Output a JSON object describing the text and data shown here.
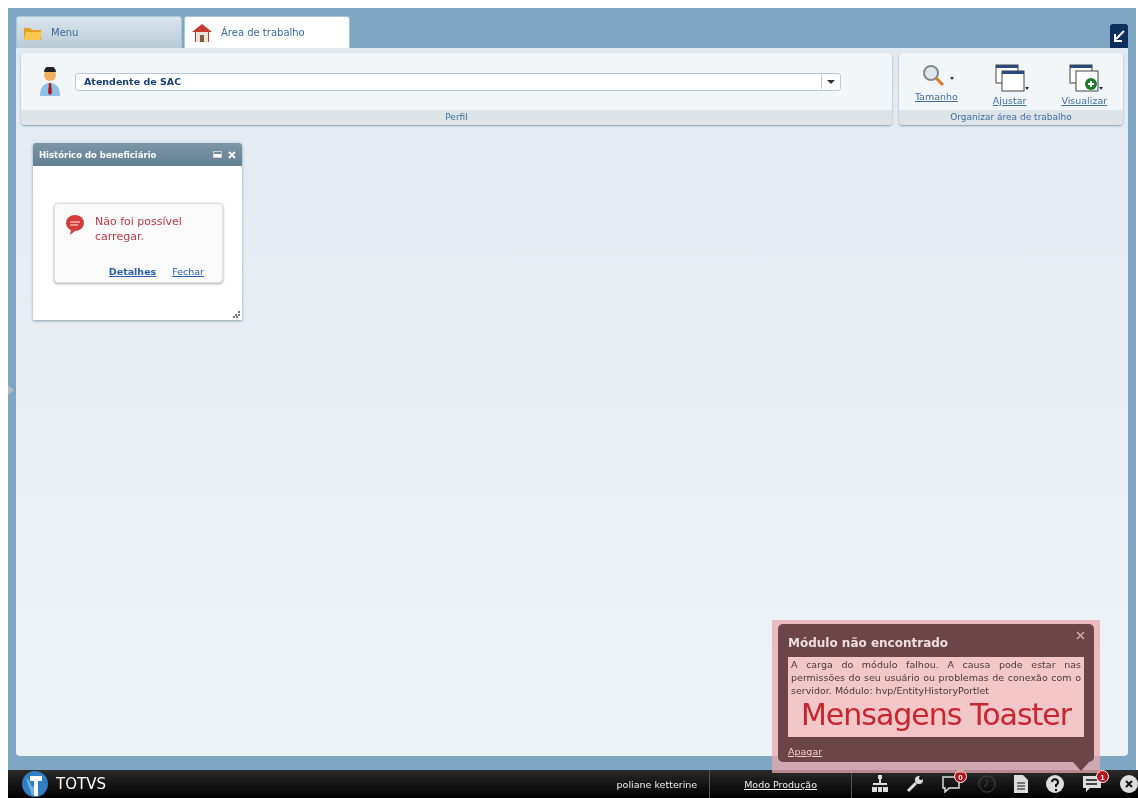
{
  "tabs": [
    {
      "label": "Menu",
      "kind": "folder",
      "selected": false
    },
    {
      "label": "Área de trabalho",
      "kind": "house",
      "selected": true
    }
  ],
  "profile": {
    "value": "Atendente de SAC",
    "section_label": "Perfil"
  },
  "organize": {
    "buttons": [
      {
        "label": "Tamanho",
        "kind": "zoom"
      },
      {
        "label": "Ajustar",
        "kind": "fit"
      },
      {
        "label": "Visualizar",
        "kind": "add"
      }
    ],
    "section_label": "Organizar área de trabalho"
  },
  "portlet": {
    "title": "Histórico do beneficiário",
    "error": {
      "message": "Não foi possível carregar.",
      "links": [
        {
          "label": "Detalhes",
          "primary": true
        },
        {
          "label": "Fechar",
          "primary": false
        }
      ]
    }
  },
  "toaster": {
    "title": "Módulo não encontrado",
    "message": "A carga do módulo falhou. A causa pode estar nas permissões do seu usuário ou problemas de conexão com o servidor. Módulo: hvp/EntityHistoryPortlet",
    "annotation": "Mensagens Toaster",
    "action": "Apagar"
  },
  "status_bar": {
    "brand": "TOTVS",
    "user": "poliane ketterine",
    "mode": "Modo Produção",
    "tools": [
      {
        "kind": "sitemap",
        "disabled": false
      },
      {
        "kind": "wrench",
        "disabled": false
      },
      {
        "kind": "comment",
        "badge": "0",
        "disabled": false
      },
      {
        "kind": "clock",
        "disabled": true
      },
      {
        "kind": "document",
        "disabled": false
      },
      {
        "kind": "help",
        "disabled": false
      },
      {
        "kind": "messages",
        "badge": "1",
        "disabled": false
      },
      {
        "kind": "close",
        "disabled": false
      }
    ]
  }
}
